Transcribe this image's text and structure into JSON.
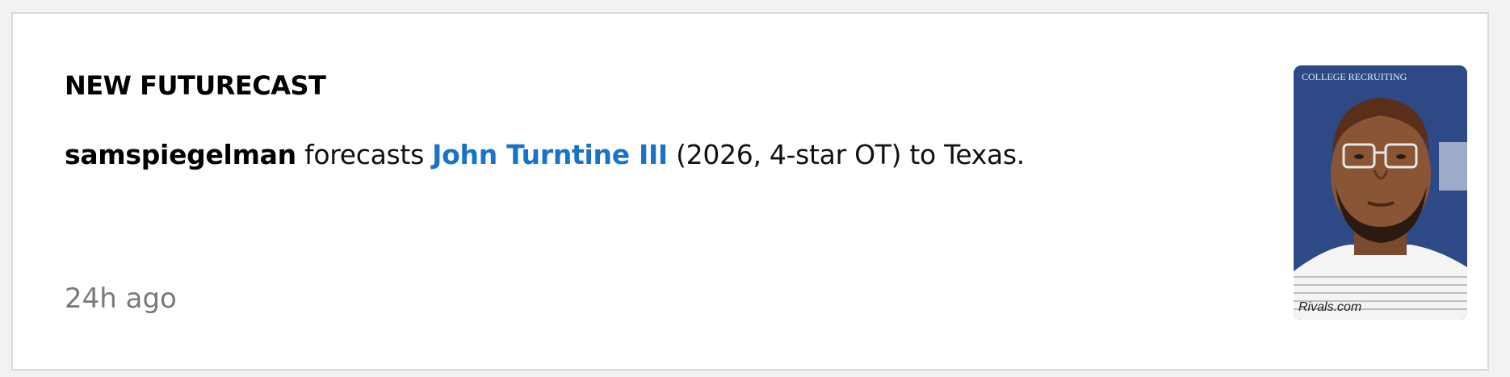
{
  "card": {
    "heading": "NEW FUTURECAST",
    "forecaster": "samspiegelman",
    "verb": " forecasts ",
    "player_name": "John Turntine III",
    "details": " (2026, 4-star OT) to Texas.",
    "timestamp": "24h ago",
    "photo": {
      "watermark": "Rivals.com",
      "backdrop_text": "COLLEGE RECRUITING"
    }
  },
  "colors": {
    "link": "#1a73c9",
    "timestamp": "#7a7a7a",
    "photo_background": "#2d4a86"
  }
}
